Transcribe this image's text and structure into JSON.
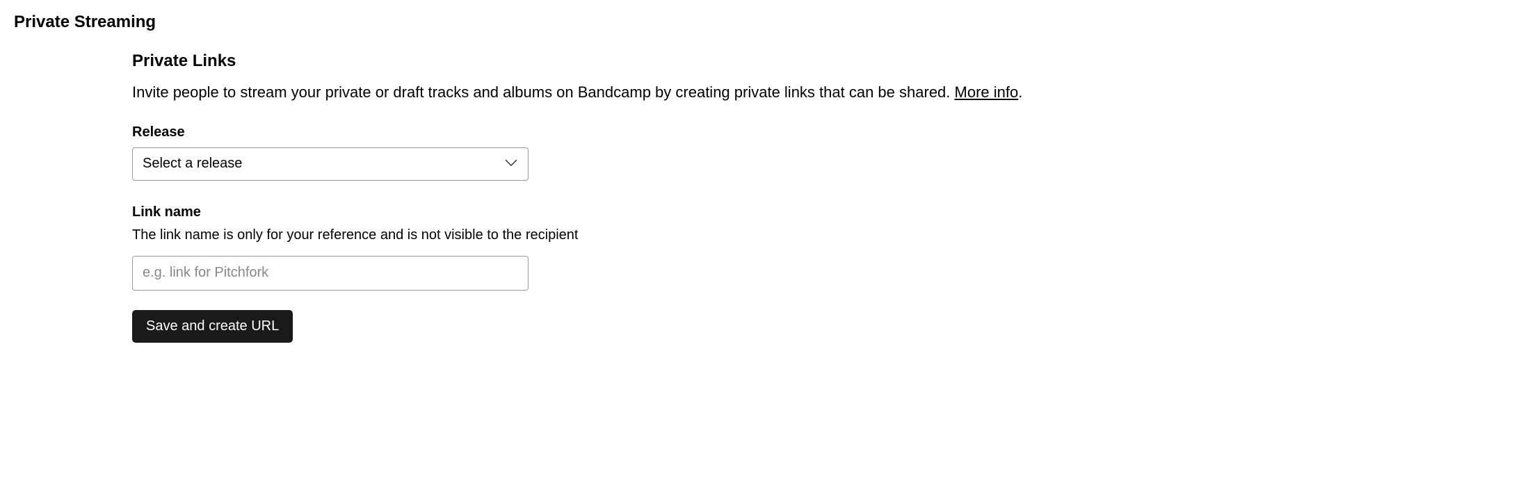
{
  "page_title": "Private Streaming",
  "section": {
    "heading": "Private Links",
    "description_text": "Invite people to stream your private or draft tracks and albums on Bandcamp by creating private links that can be shared. ",
    "more_info_label": "More info",
    "trailing_punct": "."
  },
  "release": {
    "label": "Release",
    "selected": "Select a release"
  },
  "link_name": {
    "label": "Link name",
    "help": "The link name is only for your reference and is not visible to the recipient",
    "placeholder": "e.g. link for Pitchfork",
    "value": ""
  },
  "actions": {
    "save_button": "Save and create URL"
  }
}
